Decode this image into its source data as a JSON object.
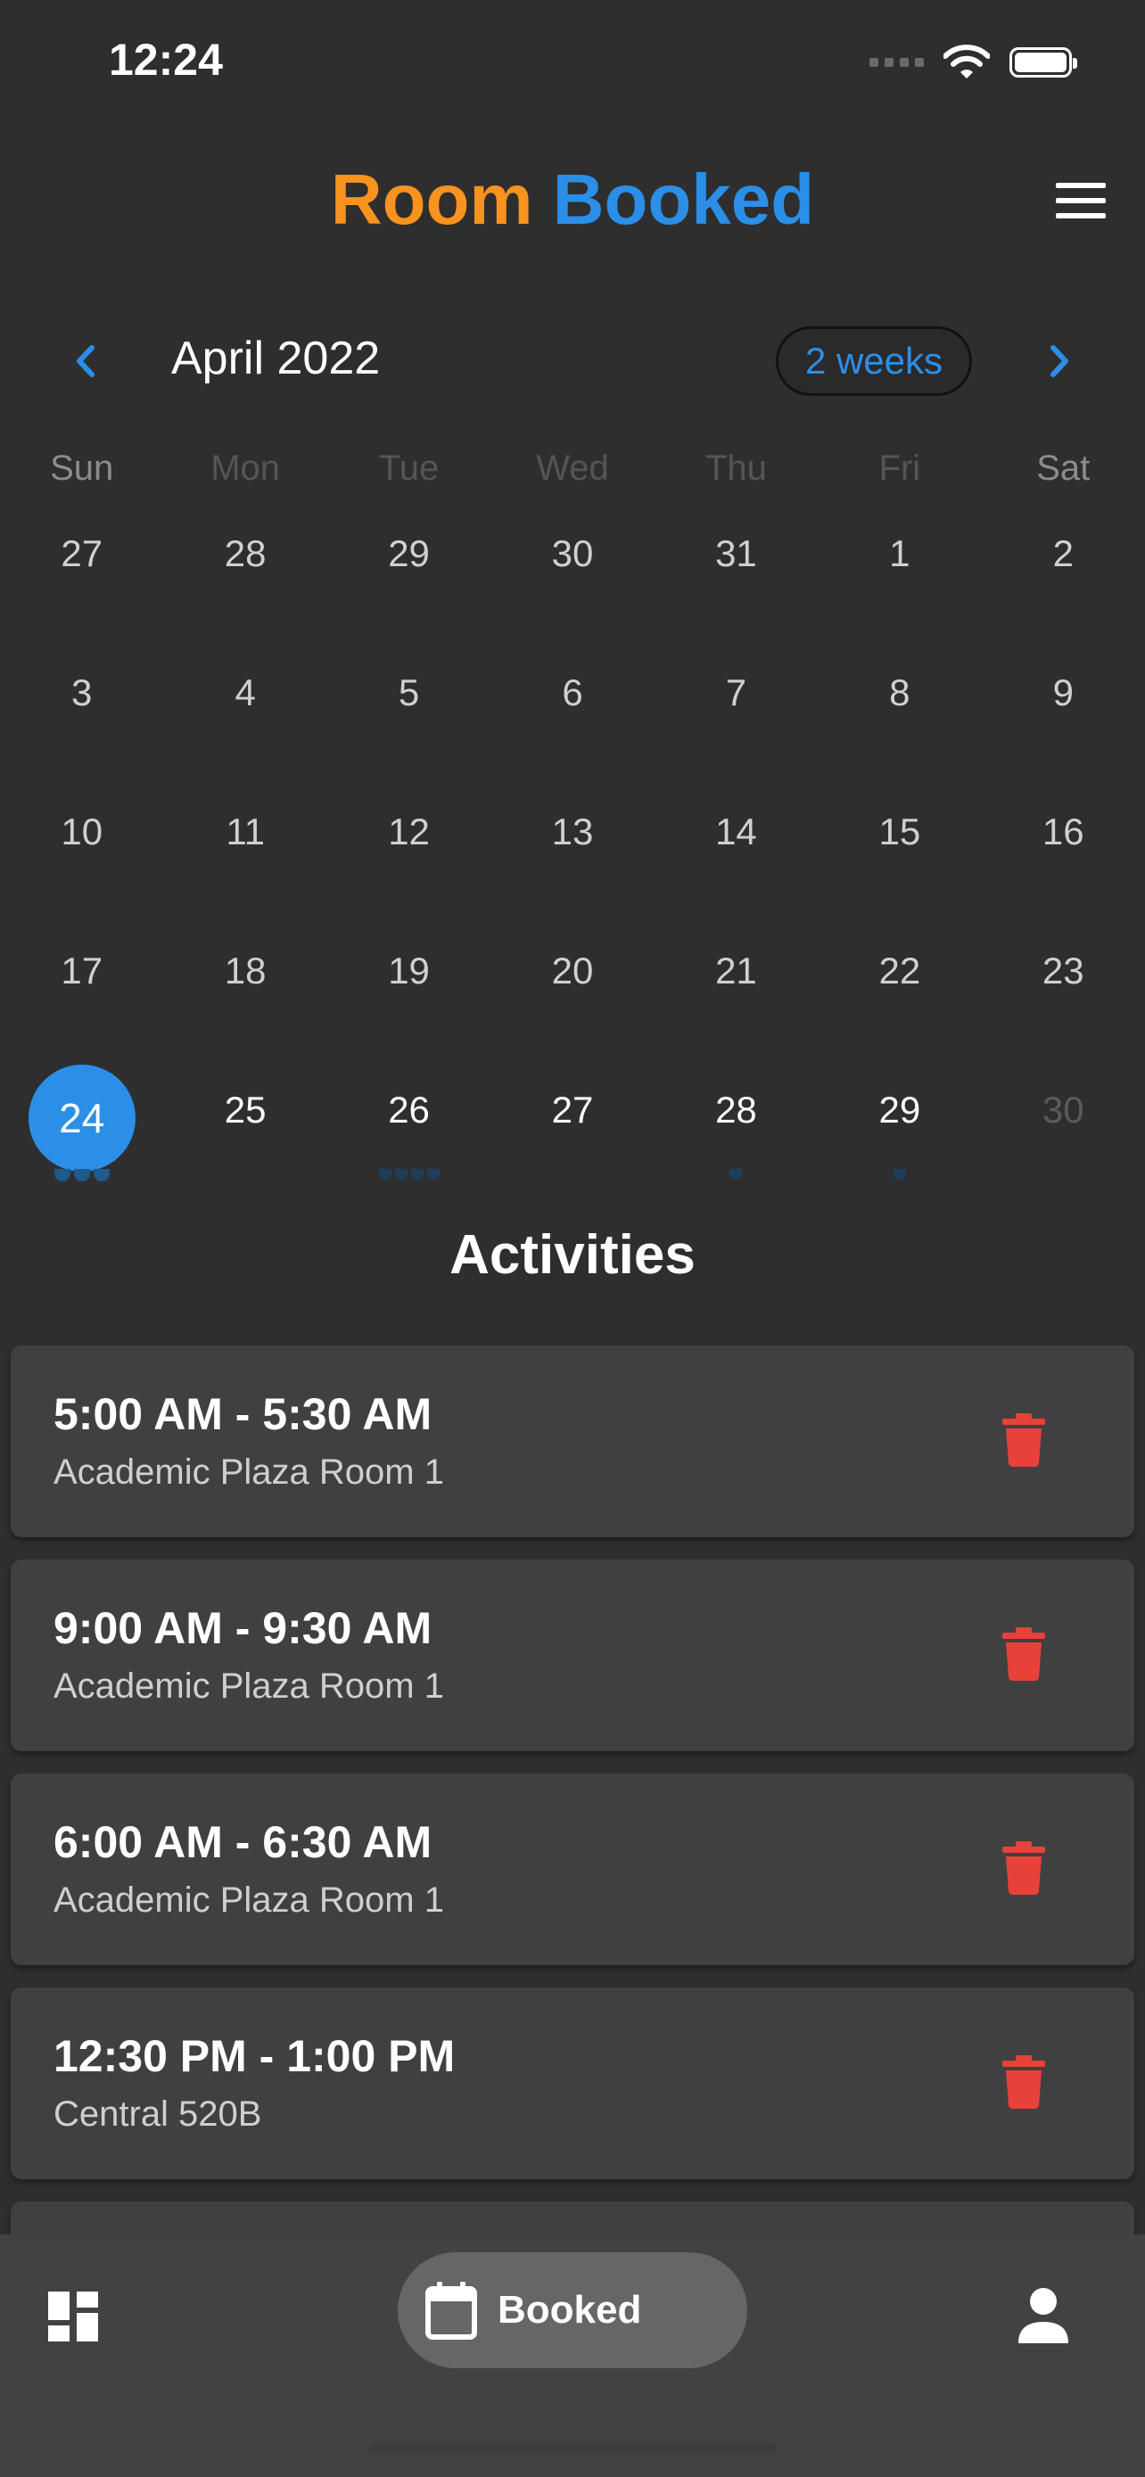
{
  "status_bar": {
    "time": "12:24"
  },
  "header": {
    "title_part1": "Room",
    "title_part2": "Booked"
  },
  "calendar": {
    "month_label": "April 2022",
    "format_button": "2 weeks",
    "weekdays": [
      "Sun",
      "Mon",
      "Tue",
      "Wed",
      "Thu",
      "Fri",
      "Sat"
    ],
    "weeks": [
      [
        "27",
        "28",
        "29",
        "30",
        "31",
        "1",
        "2"
      ],
      [
        "3",
        "4",
        "5",
        "6",
        "7",
        "8",
        "9"
      ],
      [
        "10",
        "11",
        "12",
        "13",
        "14",
        "15",
        "16"
      ],
      [
        "17",
        "18",
        "19",
        "20",
        "21",
        "22",
        "23"
      ],
      [
        "24",
        "25",
        "26",
        "27",
        "28",
        "29",
        "30"
      ]
    ],
    "selected_day": "24"
  },
  "activities": {
    "title": "Activities",
    "items": [
      {
        "time": "5:00 AM - 5:30 AM",
        "room": "Academic Plaza Room 1"
      },
      {
        "time": "9:00 AM - 9:30 AM",
        "room": "Academic Plaza Room 1"
      },
      {
        "time": "6:00 AM - 6:30 AM",
        "room": "Academic Plaza Room 1"
      },
      {
        "time": "12:30 PM - 1:00 PM",
        "room": "Central 520B"
      }
    ]
  },
  "bottom_nav": {
    "booked_label": "Booked"
  },
  "colors": {
    "accent_orange": "#f7931e",
    "accent_blue": "#2b8fe8",
    "delete_red": "#e8413a"
  },
  "icons": [
    "signal-icon",
    "wifi-icon",
    "battery-icon",
    "menu-icon",
    "chevron-left-icon",
    "chevron-right-icon",
    "trash-icon",
    "dashboard-icon",
    "calendar-icon",
    "profile-icon"
  ]
}
